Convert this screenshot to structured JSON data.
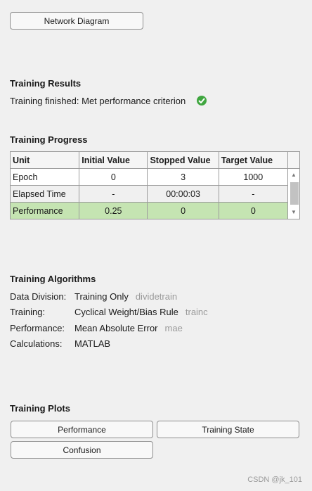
{
  "network_diagram_button": "Network Diagram",
  "results": {
    "title": "Training Results",
    "status": "Training finished: Met performance criterion"
  },
  "progress": {
    "title": "Training Progress",
    "headers": [
      "Unit",
      "Initial Value",
      "Stopped Value",
      "Target Value"
    ],
    "rows": [
      {
        "unit": "Epoch",
        "initial": "0",
        "stopped": "3",
        "target": "1000"
      },
      {
        "unit": "Elapsed Time",
        "initial": "-",
        "stopped": "00:00:03",
        "target": "-"
      },
      {
        "unit": "Performance",
        "initial": "0.25",
        "stopped": "0",
        "target": "0"
      }
    ]
  },
  "algorithms": {
    "title": "Training Algorithms",
    "rows": [
      {
        "label": "Data Division:",
        "value": "Training Only",
        "fn": "dividetrain"
      },
      {
        "label": "Training:",
        "value": "Cyclical Weight/Bias Rule",
        "fn": "trainc"
      },
      {
        "label": "Performance:",
        "value": "Mean Absolute Error",
        "fn": "mae"
      },
      {
        "label": "Calculations:",
        "value": "MATLAB",
        "fn": ""
      }
    ]
  },
  "plots": {
    "title": "Training Plots",
    "buttons": {
      "performance": "Performance",
      "training_state": "Training State",
      "confusion": "Confusion"
    }
  },
  "watermark": "CSDN @jk_101",
  "colors": {
    "highlight_row": "#c5e4b2",
    "success": "#3fa63f",
    "muted_text": "#9a9a9a"
  },
  "icons": {
    "status": "check-circle-icon",
    "scroll_up": "arrow-up-icon",
    "scroll_down": "arrow-down-icon"
  }
}
